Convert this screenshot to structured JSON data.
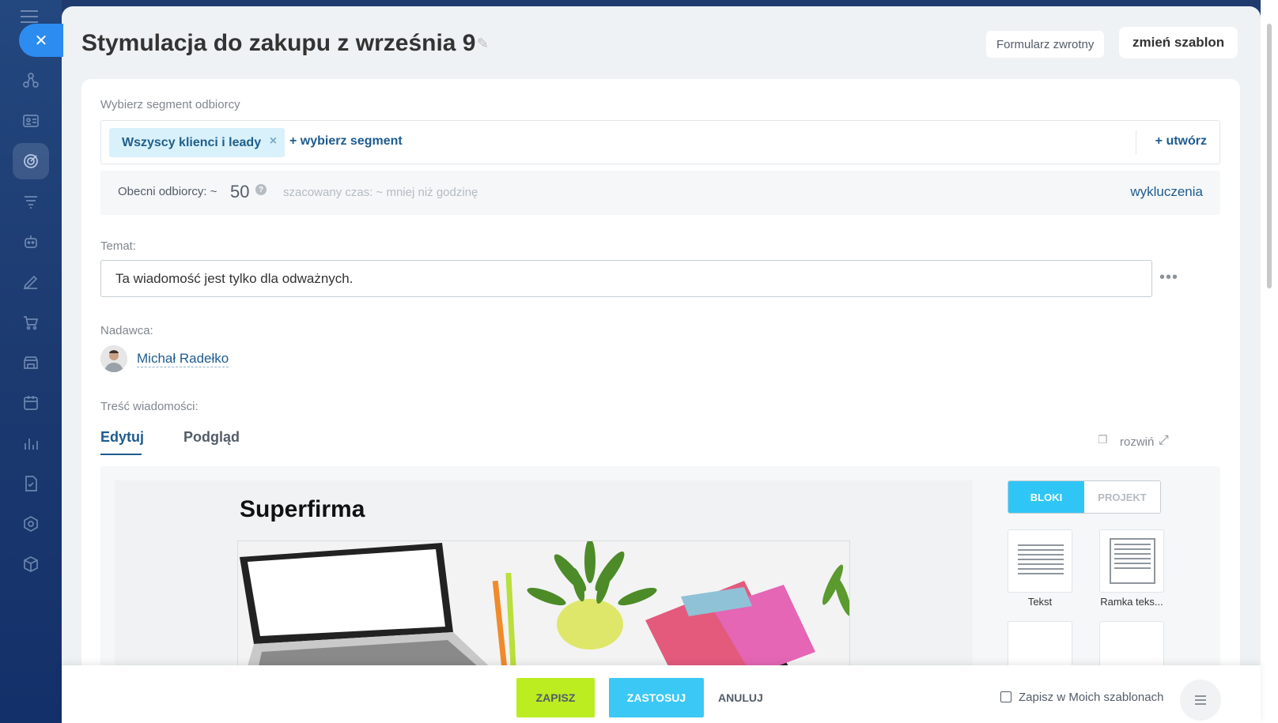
{
  "header": {
    "title": "Stymulacja do zakupu z września 9",
    "feedback_button": "Formularz zwrotny",
    "change_template_button": "zmień szablon"
  },
  "segment": {
    "label": "Wybierz segment odbiorcy",
    "chip": "Wszyscy klienci i leady",
    "add_segment": "wybierz segment",
    "create": "utwórz"
  },
  "recipients": {
    "label": "Obecni odbiorcy: ~",
    "count": "50",
    "estimate": "szacowany czas: ~ mniej niż godzinę",
    "exclusions": "wykluczenia"
  },
  "subject": {
    "label": "Temat:",
    "value": "Ta wiadomość jest tylko dla odważnych."
  },
  "sender": {
    "label": "Nadawca:",
    "name": "Michał Radełko"
  },
  "content": {
    "label": "Treść wiadomości:",
    "tabs": [
      "Edytuj",
      "Podgląd"
    ],
    "expand": "rozwiń"
  },
  "editor": {
    "heading": "Superfirma",
    "modes": [
      "BLOKI",
      "PROJEKT"
    ],
    "blocks": [
      "Tekst",
      "Ramka teks..."
    ]
  },
  "footer": {
    "save": "ZAPISZ",
    "apply": "ZASTOSUJ",
    "cancel": "ANULUJ",
    "save_template": "Zapisz w Moich szablonach"
  },
  "colors": {
    "accent_blue": "#2fc6f6",
    "save_green": "#bbed21",
    "link_blue": "#1e5b8f"
  }
}
